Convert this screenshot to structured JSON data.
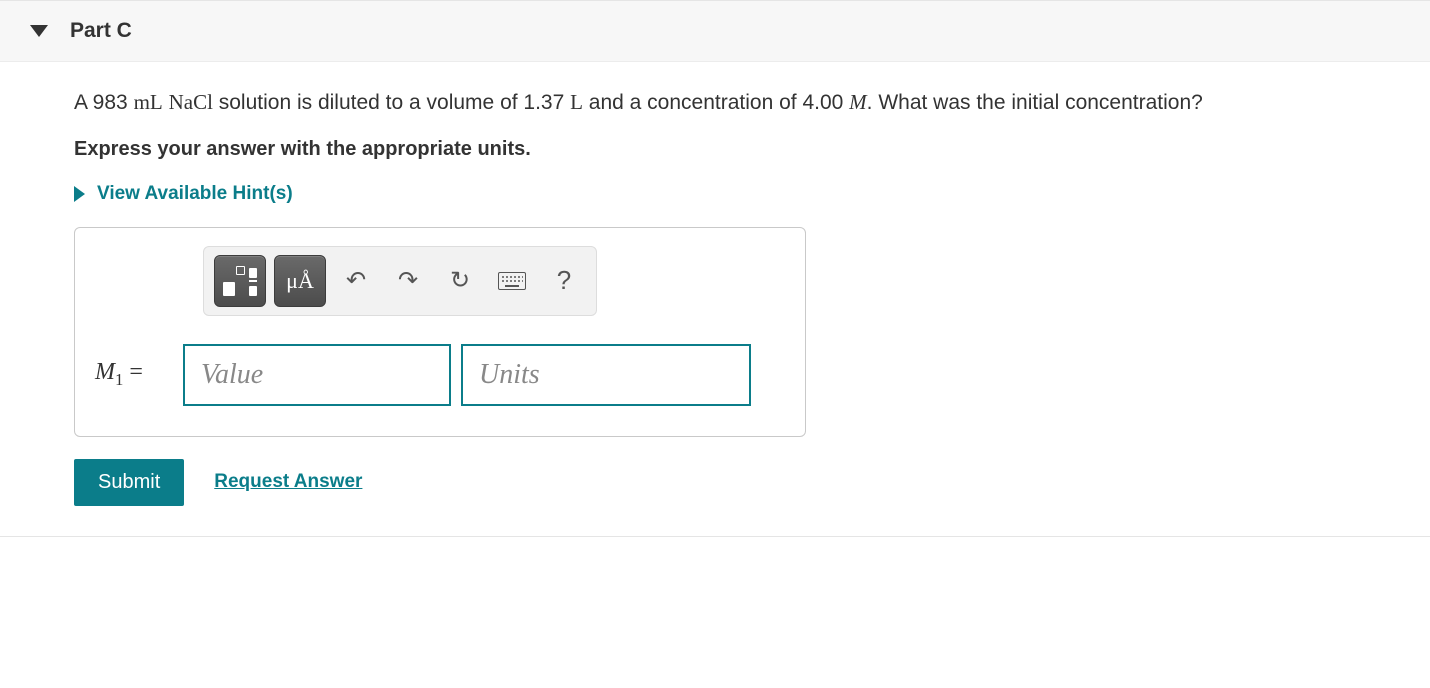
{
  "header": {
    "title": "Part C"
  },
  "question": {
    "t1": "A 983 ",
    "u1": "mL",
    "t2": " ",
    "chem": "NaCl",
    "t3": " solution is diluted to a volume of 1.37 ",
    "u2": "L",
    "t4": " and a concentration of 4.00 ",
    "u3": "M",
    "t5": ". What was the initial concentration?"
  },
  "instruction": "Express your answer with the appropriate units.",
  "hints_label": "View Available Hint(s)",
  "toolbar": {
    "mu_label": "μÅ",
    "undo": "↶",
    "redo": "↷",
    "reset": "↻",
    "help": "?"
  },
  "answer": {
    "var_html": "M",
    "sub": "1",
    "eq": " = ",
    "value_placeholder": "Value",
    "units_placeholder": "Units"
  },
  "actions": {
    "submit": "Submit",
    "request": "Request Answer"
  }
}
